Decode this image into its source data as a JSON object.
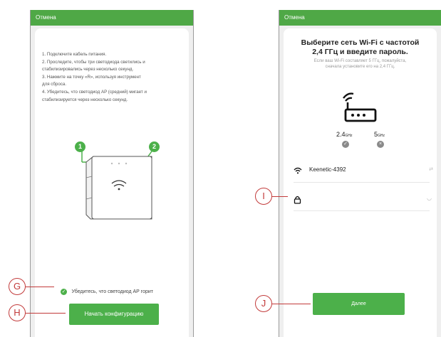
{
  "left_screen": {
    "topbar_label": "Отмена",
    "instructions": [
      "1. Подключите кабель питания.",
      "2. Проследите, чтобы три светодиода светились и",
      "стабилизировались через несколько секунд.",
      "3. Нажмите на точку «R», используя инструмент",
      "для сброса.",
      "4. Убедитесь, что светодиод AP (средний) мигает и",
      "стабилизируется через несколько секунд."
    ],
    "badge_1": "1",
    "badge_2": "2",
    "confirm_text": "Убедитесь, что светодиод AP горит",
    "start_button_label": "Начать конфигурацию"
  },
  "right_screen": {
    "topbar_label": "Отмена",
    "title_line1": "Выберите сеть Wi-Fi с частотой",
    "title_line2": "2,4 ГГц и введите пароль.",
    "subtitle_line1": "Если ваш Wi-Fi составляет 5 ГГц, пожалуйста,",
    "subtitle_line2": "сначала установите его на 2,4 ГГц.",
    "band_24_label": "2.4",
    "band_24_unit": "GHz",
    "band_5_label": "5",
    "band_5_unit": "GHz",
    "network_name": "Keenetic-4392",
    "password_value": "",
    "next_button_label": "Далее"
  },
  "callouts": {
    "g": "G",
    "h": "H",
    "i": "I",
    "j": "J"
  },
  "colors": {
    "accent_green": "#4fa846",
    "callout_red": "#c23a3a"
  }
}
